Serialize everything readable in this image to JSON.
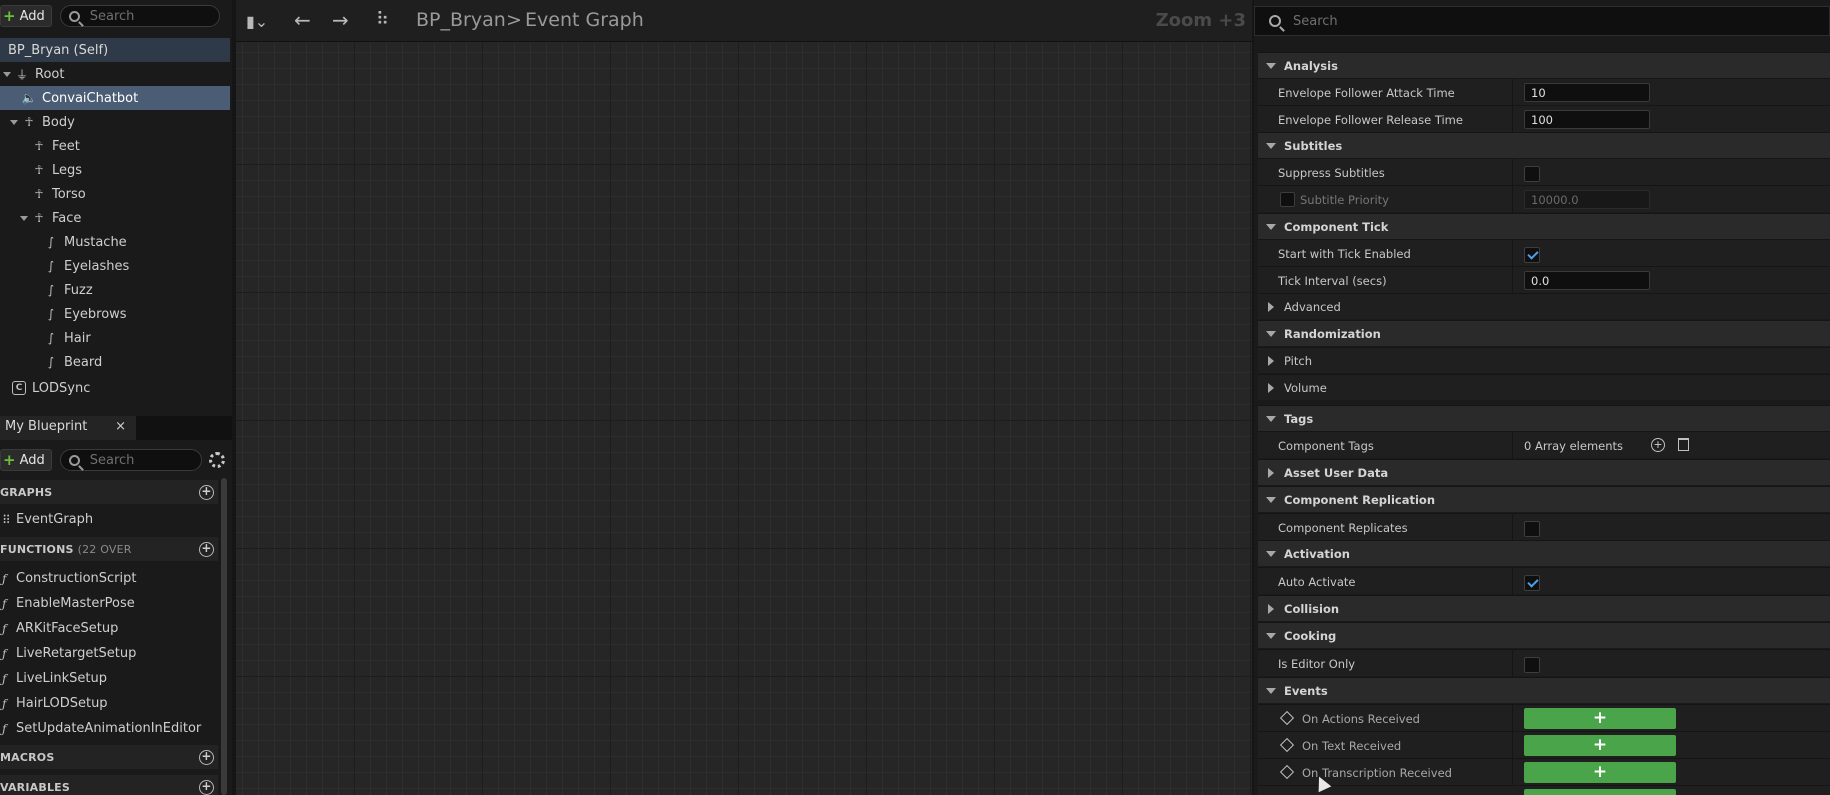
{
  "components": {
    "add_label": "Add",
    "search_placeholder": "Search",
    "self_label": "BP_Bryan (Self)",
    "tree": [
      {
        "label": "Root",
        "icon": "scene-component-icon"
      },
      {
        "label": "ConvaiChatbot",
        "icon": "speaker-icon"
      },
      {
        "label": "Body",
        "icon": "skeleton-icon"
      },
      {
        "label": "Feet",
        "icon": "skeleton-icon"
      },
      {
        "label": "Legs",
        "icon": "skeleton-icon"
      },
      {
        "label": "Torso",
        "icon": "skeleton-icon"
      },
      {
        "label": "Face",
        "icon": "skeleton-icon"
      },
      {
        "label": "Mustache",
        "icon": "groom-icon"
      },
      {
        "label": "Eyelashes",
        "icon": "groom-icon"
      },
      {
        "label": "Fuzz",
        "icon": "groom-icon"
      },
      {
        "label": "Eyebrows",
        "icon": "groom-icon"
      },
      {
        "label": "Hair",
        "icon": "groom-icon"
      },
      {
        "label": "Beard",
        "icon": "groom-icon"
      },
      {
        "label": "LODSync",
        "icon": "component-icon"
      }
    ]
  },
  "my_blueprint": {
    "tab_label": "My Blueprint",
    "close_glyph": "×",
    "add_label": "Add",
    "search_placeholder": "Search",
    "graphs_label": "GRAPHS",
    "event_graph_label": "EventGraph",
    "functions_label": "FUNCTIONS",
    "functions_count": "(22 OVER",
    "functions": [
      "ConstructionScript",
      "EnableMasterPose",
      "ARKitFaceSetup",
      "LiveRetargetSetup",
      "LiveLinkSetup",
      "HairLODSetup",
      "SetUpdateAnimationInEditor"
    ],
    "macros_label": "MACROS",
    "variables_label": "VARIABLES"
  },
  "graph": {
    "blueprint_name": "BP_Bryan",
    "separator": ">",
    "graph_name": "Event Graph",
    "zoom_label": "Zoom +3",
    "back_glyph": "←",
    "forward_glyph": "→"
  },
  "details": {
    "search_placeholder": "Search",
    "analysis": {
      "title": "Analysis",
      "attack_label": "Envelope Follower Attack Time",
      "attack_value": "10",
      "release_label": "Envelope Follower Release Time",
      "release_value": "100"
    },
    "subtitles": {
      "title": "Subtitles",
      "suppress_label": "Suppress Subtitles",
      "priority_label": "Subtitle Priority",
      "priority_value": "10000.0"
    },
    "component_tick": {
      "title": "Component Tick",
      "start_label": "Start with Tick Enabled",
      "interval_label": "Tick Interval (secs)",
      "interval_value": "0.0",
      "advanced_label": "Advanced"
    },
    "randomization": {
      "title": "Randomization",
      "pitch_label": "Pitch",
      "volume_label": "Volume"
    },
    "tags": {
      "title": "Tags",
      "component_tags_label": "Component Tags",
      "component_tags_value": "0 Array elements"
    },
    "asset_user_data_label": "Asset User Data",
    "replication": {
      "title": "Component Replication",
      "replicates_label": "Component Replicates"
    },
    "activation": {
      "title": "Activation",
      "auto_activate_label": "Auto Activate"
    },
    "collision_label": "Collision",
    "cooking": {
      "title": "Cooking",
      "editor_only_label": "Is Editor Only"
    },
    "events": {
      "title": "Events",
      "items": [
        "On Actions Received",
        "On Text Received",
        "On Transcription Received"
      ],
      "add_glyph": "+"
    }
  }
}
